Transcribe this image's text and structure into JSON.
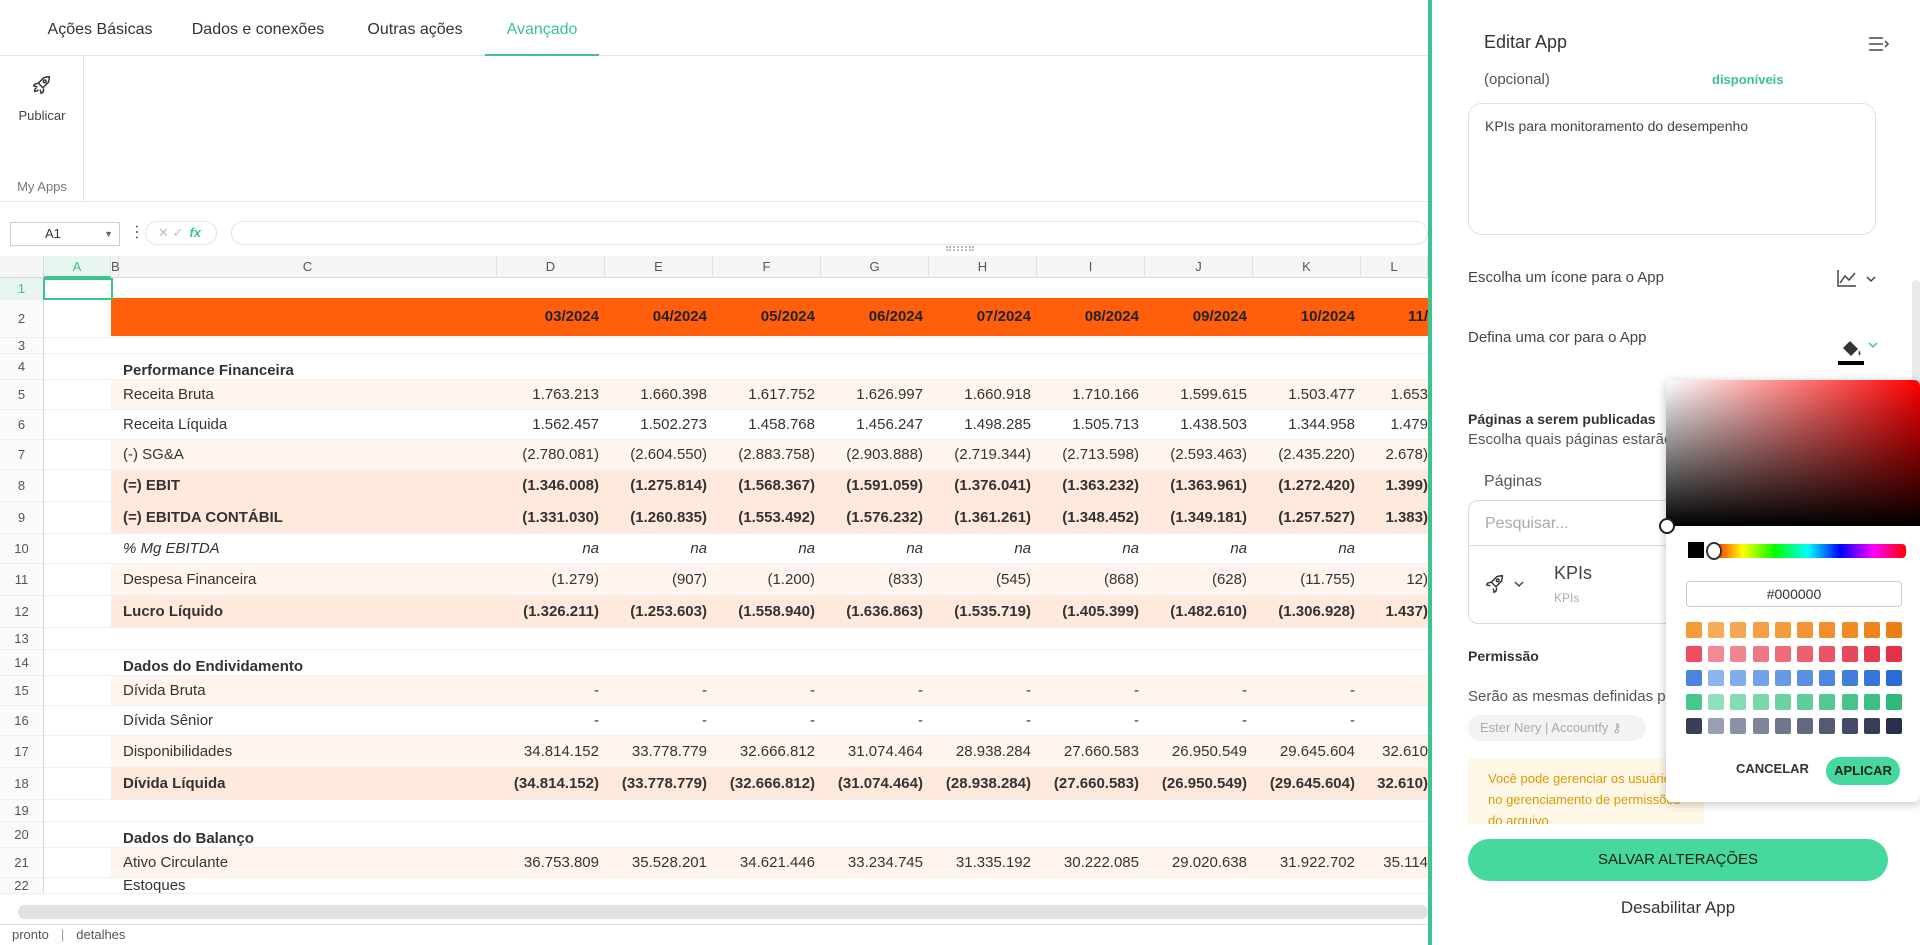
{
  "toolbar": {
    "tabs": [
      "Ações Básicas",
      "Dados e conexões",
      "Outras ações",
      "Avançado"
    ],
    "active_tab": "Avançado",
    "publish_label": "Publicar",
    "group_label": "My Apps"
  },
  "formula_bar": {
    "cell_ref": "A1",
    "formula": "",
    "fx_label": "fx"
  },
  "sheet": {
    "columns": [
      "A",
      "B",
      "C",
      "D",
      "E",
      "F",
      "G",
      "H",
      "I",
      "J",
      "K",
      "L"
    ],
    "selected_cell": "A1",
    "period_headers": [
      "03/2024",
      "04/2024",
      "05/2024",
      "06/2024",
      "07/2024",
      "08/2024",
      "09/2024",
      "10/2024",
      "11/"
    ],
    "rows": [
      {
        "n": "1",
        "label": "",
        "values": [],
        "style": "blank"
      },
      {
        "n": "2",
        "label": "",
        "values": [],
        "style": "header"
      },
      {
        "n": "3",
        "label": "",
        "values": [],
        "style": "blank"
      },
      {
        "n": "4",
        "label": "Performance Financeira",
        "values": [],
        "style": "section"
      },
      {
        "n": "5",
        "label": "Receita Bruta",
        "values": [
          "1.763.213",
          "1.660.398",
          "1.617.752",
          "1.626.997",
          "1.660.918",
          "1.710.166",
          "1.599.615",
          "1.503.477",
          "1.653"
        ],
        "style": "shaded"
      },
      {
        "n": "6",
        "label": "Receita Líquida",
        "values": [
          "1.562.457",
          "1.502.273",
          "1.458.768",
          "1.456.247",
          "1.498.285",
          "1.505.713",
          "1.438.503",
          "1.344.958",
          "1.479"
        ],
        "style": "plain"
      },
      {
        "n": "7",
        "label": "(-) SG&A",
        "values": [
          "(2.780.081)",
          "(2.604.550)",
          "(2.883.758)",
          "(2.903.888)",
          "(2.719.344)",
          "(2.713.598)",
          "(2.593.463)",
          "(2.435.220)",
          "(2.678"
        ],
        "style": "shaded"
      },
      {
        "n": "8",
        "label": "(=) EBIT",
        "values": [
          "(1.346.008)",
          "(1.275.814)",
          "(1.568.367)",
          "(1.591.059)",
          "(1.376.041)",
          "(1.363.232)",
          "(1.363.961)",
          "(1.272.420)",
          "(1.399"
        ],
        "style": "bold"
      },
      {
        "n": "9",
        "label": "(=) EBITDA CONTÁBIL",
        "values": [
          "(1.331.030)",
          "(1.260.835)",
          "(1.553.492)",
          "(1.576.232)",
          "(1.361.261)",
          "(1.348.452)",
          "(1.349.181)",
          "(1.257.527)",
          "(1.383"
        ],
        "style": "bold"
      },
      {
        "n": "10",
        "label": "% Mg EBITDA",
        "values": [
          "na",
          "na",
          "na",
          "na",
          "na",
          "na",
          "na",
          "na",
          ""
        ],
        "style": "italic"
      },
      {
        "n": "11",
        "label": "Despesa Financeira",
        "values": [
          "(1.279)",
          "(907)",
          "(1.200)",
          "(833)",
          "(545)",
          "(868)",
          "(628)",
          "(11.755)",
          "(12"
        ],
        "style": "shaded"
      },
      {
        "n": "12",
        "label": "Lucro Líquido",
        "values": [
          "(1.326.211)",
          "(1.253.603)",
          "(1.558.940)",
          "(1.636.863)",
          "(1.535.719)",
          "(1.405.399)",
          "(1.482.610)",
          "(1.306.928)",
          "(1.437"
        ],
        "style": "bold"
      },
      {
        "n": "13",
        "label": "",
        "values": [],
        "style": "blank"
      },
      {
        "n": "14",
        "label": "Dados do Endividamento",
        "values": [],
        "style": "section"
      },
      {
        "n": "15",
        "label": "Dívida Bruta",
        "values": [
          "-",
          "-",
          "-",
          "-",
          "-",
          "-",
          "-",
          "-",
          ""
        ],
        "style": "shaded"
      },
      {
        "n": "16",
        "label": "Dívida Sênior",
        "values": [
          "-",
          "-",
          "-",
          "-",
          "-",
          "-",
          "-",
          "-",
          ""
        ],
        "style": "plain"
      },
      {
        "n": "17",
        "label": "Disponibilidades",
        "values": [
          "34.814.152",
          "33.778.779",
          "32.666.812",
          "31.074.464",
          "28.938.284",
          "27.660.583",
          "26.950.549",
          "29.645.604",
          "32.610"
        ],
        "style": "shaded"
      },
      {
        "n": "18",
        "label": "Dívida Líquida",
        "values": [
          "(34.814.152)",
          "(33.778.779)",
          "(32.666.812)",
          "(31.074.464)",
          "(28.938.284)",
          "(27.660.583)",
          "(26.950.549)",
          "(29.645.604)",
          "(32.610"
        ],
        "style": "bold"
      },
      {
        "n": "19",
        "label": "",
        "values": [],
        "style": "blank"
      },
      {
        "n": "20",
        "label": "Dados do Balanço",
        "values": [],
        "style": "section"
      },
      {
        "n": "21",
        "label": "Ativo Circulante",
        "values": [
          "36.753.809",
          "35.528.201",
          "34.621.446",
          "33.234.745",
          "31.335.192",
          "30.222.085",
          "29.020.638",
          "31.922.702",
          "35.114"
        ],
        "style": "shaded"
      },
      {
        "n": "22",
        "label": "Estoques",
        "values": [],
        "style": "partial"
      }
    ]
  },
  "status_bar": {
    "status": "pronto",
    "details": "detalhes"
  },
  "panel": {
    "title": "Editar App",
    "optional_label": "(opcional)",
    "available_label": "disponíveis",
    "description": "KPIs para monitoramento do desempenho",
    "icon_label": "Escolha um ícone para o App",
    "color_label": "Defina uma cor para o App",
    "pages_title": "Páginas a serem publicadas",
    "pages_sub": "Escolha quais páginas estarão",
    "pages_label": "Páginas",
    "search_placeholder": "Pesquisar...",
    "page_item": {
      "name": "KPIs",
      "sub": "KPIs"
    },
    "permission_title": "Permissão",
    "permission_sub": "Serão as mesmas definidas p",
    "user_chip": "Ester Nery | Accountfy",
    "info_text": "Você pode gerenciar os usuários no gerenciamento de permissões do arquivo",
    "save_label": "SALVAR ALTERAÇÕES",
    "disable_label": "Desabilitar App"
  },
  "color_picker": {
    "hex": "#000000",
    "cancel_label": "CANCELAR",
    "apply_label": "APLICAR",
    "palette": [
      [
        "#f59b3a",
        "#f7ac5c",
        "#f6a650",
        "#f5a044",
        "#f59b3a",
        "#f39532",
        "#f28f2a",
        "#f08a22",
        "#ee841b",
        "#ec7f14"
      ],
      [
        "#ef4d63",
        "#f08a95",
        "#f28490",
        "#f07885",
        "#ee6c7a",
        "#ec6070",
        "#ea5466",
        "#e8485c",
        "#e63c52",
        "#e43048"
      ],
      [
        "#4a86e0",
        "#8cb4ef",
        "#80abec",
        "#74a2e9",
        "#6899e6",
        "#5c90e3",
        "#5087e0",
        "#447edd",
        "#3875da",
        "#2c6cd7"
      ],
      [
        "#46c98a",
        "#8fe0ba",
        "#85dcb2",
        "#79d7aa",
        "#6dd2a2",
        "#61cd9a",
        "#55c892",
        "#49c38a",
        "#3dbe82",
        "#31b97a"
      ],
      [
        "#3a3f55",
        "#9aa0b3",
        "#8c92a6",
        "#7e8499",
        "#70768c",
        "#62687f",
        "#545a72",
        "#464c65",
        "#383e58",
        "#2a304b"
      ]
    ]
  }
}
